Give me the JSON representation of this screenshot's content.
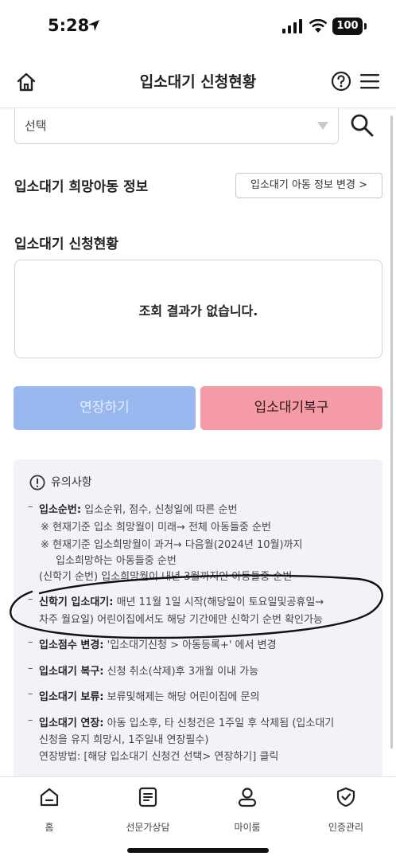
{
  "status_bar": {
    "time": "5:28",
    "battery": "100"
  },
  "header": {
    "title": "입소대기 신청현황"
  },
  "select": {
    "value": "선택"
  },
  "child_info": {
    "title": "입소대기 희망아동 정보",
    "change_button": "입소대기 아동 정보 변경 >"
  },
  "application_status": {
    "title": "입소대기 신청현황",
    "empty_message": "조회 결과가 없습니다."
  },
  "actions": {
    "extend_label": "연장하기",
    "restore_label": "입소대기복구"
  },
  "notice": {
    "title": "유의사항",
    "items": [
      {
        "term": "입소순번:",
        "text": " 입소순위, 점수, 신청일에 따른 순번",
        "notes": [
          "※ 현재기준 입소 희망월이 미래→ 전체 아동들중 순번",
          "※ 현재기준 입소희망월이 과거→ 다음월(2024년 10월)까지",
          "입소희망하는 아동들중 순번",
          "(신학기 순번) 입소희망월이 내년 3월까지인 아동들중 순번"
        ]
      },
      {
        "term": "신학기 입소대기:",
        "text": " 매년 11월 1일 시작(해당일이 토요일및공휴일→",
        "cont": "차주 월요일) 어린이집에서도 해당 기간에만 신학기 순번 확인가능"
      },
      {
        "term": "입소점수 변경:",
        "text": " '입소대기신청 > 아동등록+' 에서 변경"
      },
      {
        "term": "입소대기 복구:",
        "text": " 신청 취소(삭제)후 3개월 이내 가능"
      },
      {
        "term": "입소대기 보류:",
        "text": " 보류및해제는 해당 어린이집에 문의"
      },
      {
        "term": "입소대기 연장:",
        "text": " 아동 입소후, 타 신청건은 1주일 후 삭제됨 (입소대기",
        "cont": "신청을 유지 희망시, 1주일내 연장필수)",
        "cont2": "연장방법: [해당 입소대기 신청건 선택> 연장하기] 클릭"
      }
    ]
  },
  "bottom_nav": {
    "items": [
      {
        "label": "홈",
        "icon": "home-icon"
      },
      {
        "label": "선문가상담",
        "icon": "consult-icon"
      },
      {
        "label": "마이룸",
        "icon": "person-icon"
      },
      {
        "label": "인증관리",
        "icon": "shield-check-icon"
      }
    ]
  },
  "colors": {
    "extend_button": "#9ab8f0",
    "restore_button": "#f59ba7",
    "notice_blue": "#2e5fae",
    "notice_background": "#f2f3f6"
  }
}
